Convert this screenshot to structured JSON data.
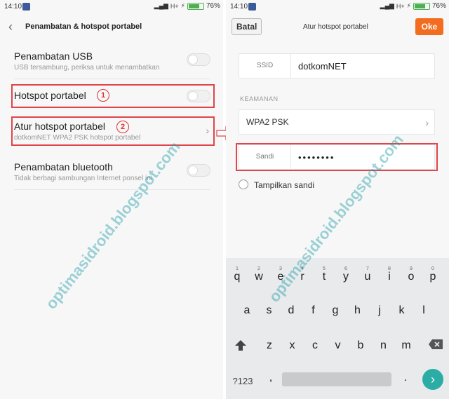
{
  "status": {
    "time": "14:10",
    "network": "H+",
    "battery_pct": "76%",
    "battery_level": 0.76
  },
  "left": {
    "header_title": "Penambatan & hotspot portabel",
    "items": [
      {
        "title": "Penambatan USB",
        "subtitle": "USB tersambung, periksa untuk menambatkan",
        "control": "toggle"
      },
      {
        "title": "Hotspot portabel",
        "subtitle": "",
        "control": "toggle"
      },
      {
        "title": "Atur hotspot portabel",
        "subtitle": "dotkomNET WPA2 PSK hotspot portabel",
        "control": "chevron"
      },
      {
        "title": "Penambatan bluetooth",
        "subtitle": "Tidak berbagi sambungan Internet ponsel ini",
        "control": "toggle"
      }
    ],
    "annotations": [
      "1",
      "2"
    ]
  },
  "right": {
    "cancel_label": "Batal",
    "header_title": "Atur hotspot portabel",
    "ok_label": "Oke",
    "ssid_label": "SSID",
    "ssid_value": "dotkomNET",
    "security_section": "KEAMANAN",
    "security_value": "WPA2 PSK",
    "password_label": "Sandi",
    "password_value": "••••••••",
    "show_password_label": "Tampilkan sandi"
  },
  "keyboard": {
    "row1": [
      "q",
      "w",
      "e",
      "r",
      "t",
      "y",
      "u",
      "i",
      "o",
      "p"
    ],
    "row1_hints": [
      "1",
      "2",
      "3",
      "4",
      "5",
      "6",
      "7",
      "8",
      "9",
      "0"
    ],
    "row2": [
      "a",
      "s",
      "d",
      "f",
      "g",
      "h",
      "j",
      "k",
      "l"
    ],
    "row3": [
      "z",
      "x",
      "c",
      "v",
      "b",
      "n",
      "m"
    ],
    "symbols_label": "?123",
    "comma": ",",
    "period": "."
  },
  "watermark": "optimasidroid.blogspot.com",
  "colors": {
    "accent": "#f26d1f",
    "highlight": "#e0454a",
    "enter": "#2bada6"
  }
}
